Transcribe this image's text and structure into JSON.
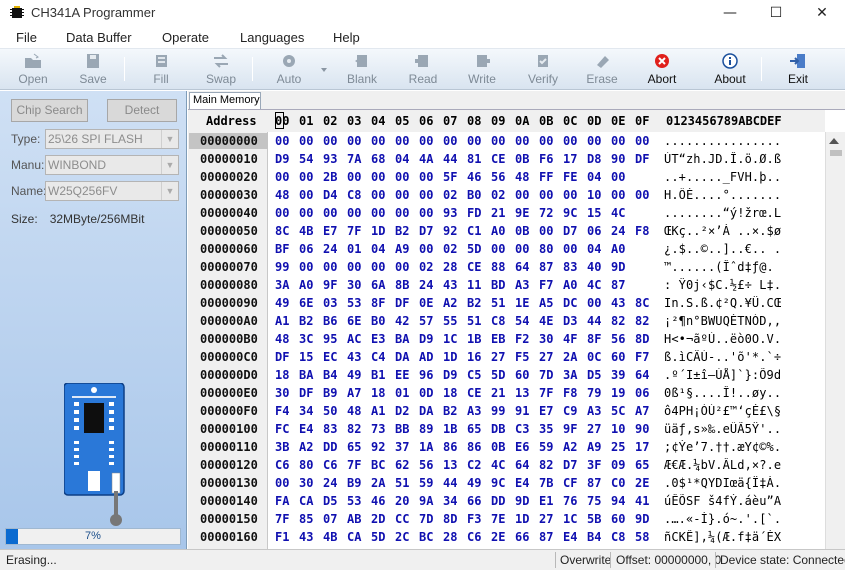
{
  "window": {
    "title": "CH341A Programmer",
    "minimize": "—",
    "maximize": "☐",
    "close": "✕"
  },
  "menu": [
    "File",
    "Data Buffer",
    "Operate",
    "Languages",
    "Help"
  ],
  "toolbar": [
    {
      "label": "Open",
      "icon": "folder-open-icon",
      "enabled": false
    },
    {
      "label": "Save",
      "icon": "floppy-save-icon",
      "enabled": false
    },
    {
      "label": "Fill",
      "icon": "fill-icon",
      "enabled": false
    },
    {
      "label": "Swap",
      "icon": "swap-arrows-icon",
      "enabled": false
    },
    {
      "label": "Auto",
      "icon": "auto-gear-icon",
      "enabled": false
    },
    {
      "label": "Blank",
      "icon": "blank-check-icon",
      "enabled": false
    },
    {
      "label": "Read",
      "icon": "read-chip-icon",
      "enabled": false
    },
    {
      "label": "Write",
      "icon": "write-chip-icon",
      "enabled": false
    },
    {
      "label": "Verify",
      "icon": "verify-chip-icon",
      "enabled": false
    },
    {
      "label": "Erase",
      "icon": "erase-chip-icon",
      "enabled": false
    },
    {
      "label": "Abort",
      "icon": "abort-stop-icon",
      "enabled": true
    },
    {
      "label": "About",
      "icon": "about-info-icon",
      "enabled": true
    },
    {
      "label": "Exit",
      "icon": "exit-door-icon",
      "enabled": true
    }
  ],
  "left_panel": {
    "chip_search": "Chip Search",
    "detect": "Detect",
    "type_label": "Type:",
    "type_value": "25\\26 SPI FLASH",
    "manu_label": "Manu:",
    "manu_value": "WINBOND",
    "name_label": "Name:",
    "name_value": "W25Q256FV",
    "size_label": "Size:",
    "size_value": "32MByte/256MBit",
    "progress_text": "7%",
    "progress_value": 0.07
  },
  "hex": {
    "tab": "Main Memory",
    "address_header": "Address",
    "columns": [
      "00",
      "01",
      "02",
      "03",
      "04",
      "05",
      "06",
      "07",
      "08",
      "09",
      "0A",
      "0B",
      "0C",
      "0D",
      "0E",
      "0F"
    ],
    "ascii_header": "0123456789ABCDEF",
    "rows": [
      {
        "addr": "00000000",
        "bytes": [
          "00",
          "00",
          "00",
          "00",
          "00",
          "00",
          "00",
          "00",
          "00",
          "00",
          "00",
          "00",
          "00",
          "00",
          "00",
          "00"
        ],
        "ascii": "................"
      },
      {
        "addr": "00000010",
        "bytes": [
          "D9",
          "54",
          "93",
          "7A",
          "68",
          "04",
          "4A",
          "44",
          "81",
          "CE",
          "0B",
          "F6",
          "17",
          "D8",
          "90",
          "DF"
        ],
        "ascii": "ÙT“zh.JD.Î.ö.Ø.ß"
      },
      {
        "addr": "00000020",
        "bytes": [
          "00",
          "00",
          "2B",
          "00",
          "00",
          "00",
          "00",
          "5F",
          "46",
          "56",
          "48",
          "FF",
          "FE",
          "04",
          "00",
          ""
        ],
        "ascii": "..+....._FVH.þ.."
      },
      {
        "addr": "00000030",
        "bytes": [
          "48",
          "00",
          "D4",
          "C8",
          "00",
          "00",
          "00",
          "02",
          "B0",
          "02",
          "00",
          "00",
          "00",
          "10",
          "00",
          "00"
        ],
        "ascii": "H.ÔÈ....°......."
      },
      {
        "addr": "00000040",
        "bytes": [
          "00",
          "00",
          "00",
          "00",
          "00",
          "00",
          "00",
          "93",
          "FD",
          "21",
          "9E",
          "72",
          "9C",
          "15",
          "4C",
          ""
        ],
        "ascii": "........“ý!žrœ.L"
      },
      {
        "addr": "00000050",
        "bytes": [
          "8C",
          "4B",
          "E7",
          "7F",
          "1D",
          "B2",
          "D7",
          "92",
          "C1",
          "A0",
          "0B",
          "00",
          "D7",
          "06",
          "24",
          "F8"
        ],
        "ascii": "ŒKç..²×’Á ..×.$ø"
      },
      {
        "addr": "00000060",
        "bytes": [
          "BF",
          "06",
          "24",
          "01",
          "04",
          "A9",
          "00",
          "02",
          "5D",
          "00",
          "00",
          "80",
          "00",
          "04",
          "A0",
          ""
        ],
        "ascii": "¿.$..©..]..€.. ."
      },
      {
        "addr": "00000070",
        "bytes": [
          "99",
          "00",
          "00",
          "00",
          "00",
          "00",
          "02",
          "28",
          "CE",
          "88",
          "64",
          "87",
          "83",
          "40",
          "9D",
          ""
        ],
        "ascii": "™......(Îˆd‡ƒ@."
      },
      {
        "addr": "00000080",
        "bytes": [
          "3A",
          "A0",
          "9F",
          "30",
          "6A",
          "8B",
          "24",
          "43",
          "11",
          "BD",
          "A3",
          "F7",
          "A0",
          "4C",
          "87",
          ""
        ],
        "ascii": ": Ÿ0j‹$C.½£÷ L‡."
      },
      {
        "addr": "00000090",
        "bytes": [
          "49",
          "6E",
          "03",
          "53",
          "8F",
          "DF",
          "0E",
          "A2",
          "B2",
          "51",
          "1E",
          "A5",
          "DC",
          "00",
          "43",
          "8C"
        ],
        "ascii": "In.S.ß.¢²Q.¥Ü.CŒ"
      },
      {
        "addr": "000000A0",
        "bytes": [
          "A1",
          "B2",
          "B6",
          "6E",
          "B0",
          "42",
          "57",
          "55",
          "51",
          "C8",
          "54",
          "4E",
          "D3",
          "44",
          "82",
          "82"
        ],
        "ascii": "¡²¶n°BWUQÈTNÓD‚‚"
      },
      {
        "addr": "000000B0",
        "bytes": [
          "48",
          "3C",
          "95",
          "AC",
          "E3",
          "BA",
          "D9",
          "1C",
          "1B",
          "EB",
          "F2",
          "30",
          "4F",
          "8F",
          "56",
          "8D"
        ],
        "ascii": "H<•¬ãºÙ..ëò0O.V."
      },
      {
        "addr": "000000C0",
        "bytes": [
          "DF",
          "15",
          "EC",
          "43",
          "C4",
          "DA",
          "AD",
          "1D",
          "16",
          "27",
          "F5",
          "27",
          "2A",
          "0C",
          "60",
          "F7"
        ],
        "ascii": "ß.ìCÄÚ-..'õ'*.`÷"
      },
      {
        "addr": "000000D0",
        "bytes": [
          "18",
          "BA",
          "B4",
          "49",
          "B1",
          "EE",
          "96",
          "D9",
          "C5",
          "5D",
          "60",
          "7D",
          "3A",
          "D5",
          "39",
          "64"
        ],
        "ascii": ".º´I±î–ÙÅ]`}:Õ9d"
      },
      {
        "addr": "000000E0",
        "bytes": [
          "30",
          "DF",
          "B9",
          "A7",
          "18",
          "01",
          "0D",
          "18",
          "CE",
          "21",
          "13",
          "7F",
          "F8",
          "79",
          "19",
          "06"
        ],
        "ascii": "0ß¹§....Î!..øy.."
      },
      {
        "addr": "000000F0",
        "bytes": [
          "F4",
          "34",
          "50",
          "48",
          "A1",
          "D2",
          "DA",
          "B2",
          "A3",
          "99",
          "91",
          "E7",
          "C9",
          "A3",
          "5C",
          "A7"
        ],
        "ascii": "ô4PH¡ÒÚ²£™‘çÉ£\\§"
      },
      {
        "addr": "00000100",
        "bytes": [
          "FC",
          "E4",
          "83",
          "82",
          "73",
          "BB",
          "89",
          "1B",
          "65",
          "DB",
          "C3",
          "35",
          "9F",
          "27",
          "10",
          "90"
        ],
        "ascii": "üäƒ‚s»‰.eÛÃ5Ÿ'.."
      },
      {
        "addr": "00000110",
        "bytes": [
          "3B",
          "A2",
          "DD",
          "65",
          "92",
          "37",
          "1A",
          "86",
          "86",
          "0B",
          "E6",
          "59",
          "A2",
          "A9",
          "25",
          "17"
        ],
        "ascii": ";¢Ýe’7.††.æY¢©%."
      },
      {
        "addr": "00000120",
        "bytes": [
          "C6",
          "80",
          "C6",
          "7F",
          "BC",
          "62",
          "56",
          "13",
          "C2",
          "4C",
          "64",
          "82",
          "D7",
          "3F",
          "09",
          "65"
        ],
        "ascii": "Æ€Æ.¼bV.ÂLd‚×?.e"
      },
      {
        "addr": "00000130",
        "bytes": [
          "00",
          "30",
          "24",
          "B9",
          "2A",
          "51",
          "59",
          "44",
          "49",
          "9C",
          "E4",
          "7B",
          "CF",
          "87",
          "C0",
          "2E"
        ],
        "ascii": ".0$¹*QYDIœä{Ï‡À."
      },
      {
        "addr": "00000140",
        "bytes": [
          "FA",
          "CA",
          "D5",
          "53",
          "46",
          "20",
          "9A",
          "34",
          "66",
          "DD",
          "9D",
          "E1",
          "76",
          "75",
          "94",
          "41"
        ],
        "ascii": "úÊÕSF š4fÝ.áèu”A"
      },
      {
        "addr": "00000150",
        "bytes": [
          "7F",
          "85",
          "07",
          "AB",
          "2D",
          "CC",
          "7D",
          "8D",
          "F3",
          "7E",
          "1D",
          "27",
          "1C",
          "5B",
          "60",
          "9D"
        ],
        "ascii": ".….«-Ì}.ó~.'.[`."
      },
      {
        "addr": "00000160",
        "bytes": [
          "F1",
          "43",
          "4B",
          "CA",
          "5D",
          "2C",
          "BC",
          "28",
          "C6",
          "2E",
          "66",
          "87",
          "E4",
          "B4",
          "C8",
          "58"
        ],
        "ascii": "ñCKÊ],¼(Æ.f‡ä´ÈX"
      }
    ]
  },
  "status": {
    "left": "Erasing...",
    "mode": "Overwrite",
    "offset": "Offset: 00000000, 0",
    "device": "Device state: Connected."
  }
}
